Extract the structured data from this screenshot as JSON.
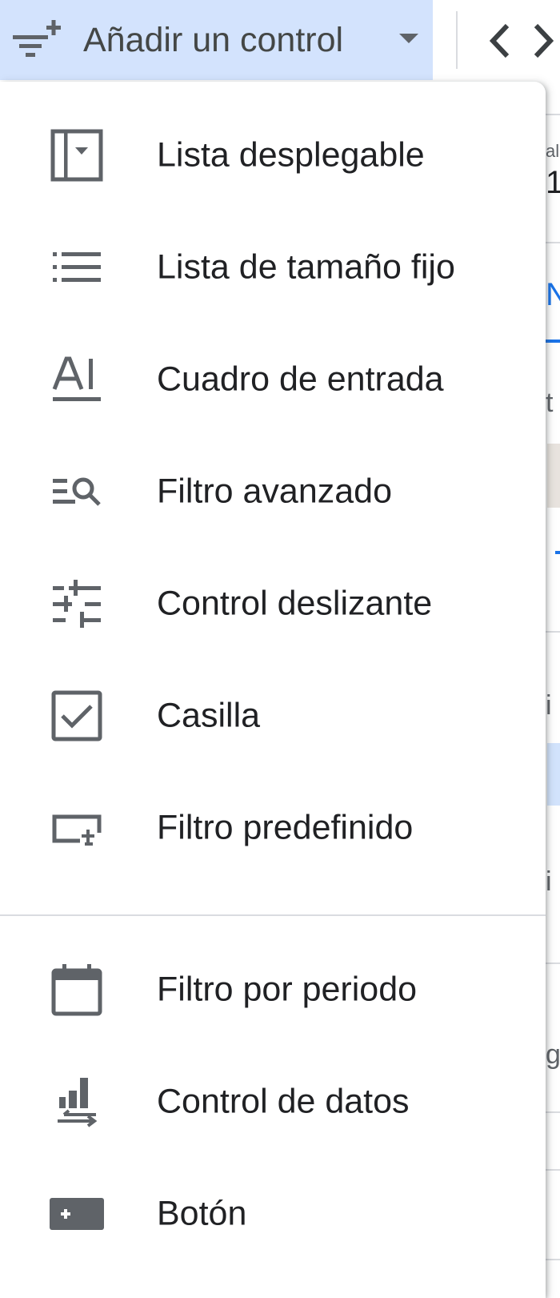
{
  "toolbar": {
    "add_control_label": "Añadir un control",
    "add_control_icon": "filter-add-icon",
    "code_icon": "code-icon"
  },
  "background_fragments": [
    "al",
    "1",
    "N",
    "t",
    "i",
    "i",
    "g"
  ],
  "menu": {
    "group1": [
      {
        "label": "Lista desplegable",
        "icon": "dropdown-list-icon"
      },
      {
        "label": "Lista de tamaño fijo",
        "icon": "fixed-list-icon"
      },
      {
        "label": "Cuadro de entrada",
        "icon": "input-box-icon"
      },
      {
        "label": "Filtro avanzado",
        "icon": "advanced-filter-icon"
      },
      {
        "label": "Control deslizante",
        "icon": "slider-icon"
      },
      {
        "label": "Casilla",
        "icon": "checkbox-icon"
      },
      {
        "label": "Filtro predefinido",
        "icon": "preset-filter-icon"
      }
    ],
    "group2": [
      {
        "label": "Filtro por periodo",
        "icon": "calendar-icon"
      },
      {
        "label": "Control de datos",
        "icon": "data-control-icon"
      },
      {
        "label": "Botón",
        "icon": "button-icon"
      }
    ]
  },
  "colors": {
    "toolbar_button_bg": "#d3e3fd",
    "icon_gray": "#5f6368",
    "text": "#202124",
    "divider": "#dadce0",
    "accent_blue": "#1a73e8"
  }
}
